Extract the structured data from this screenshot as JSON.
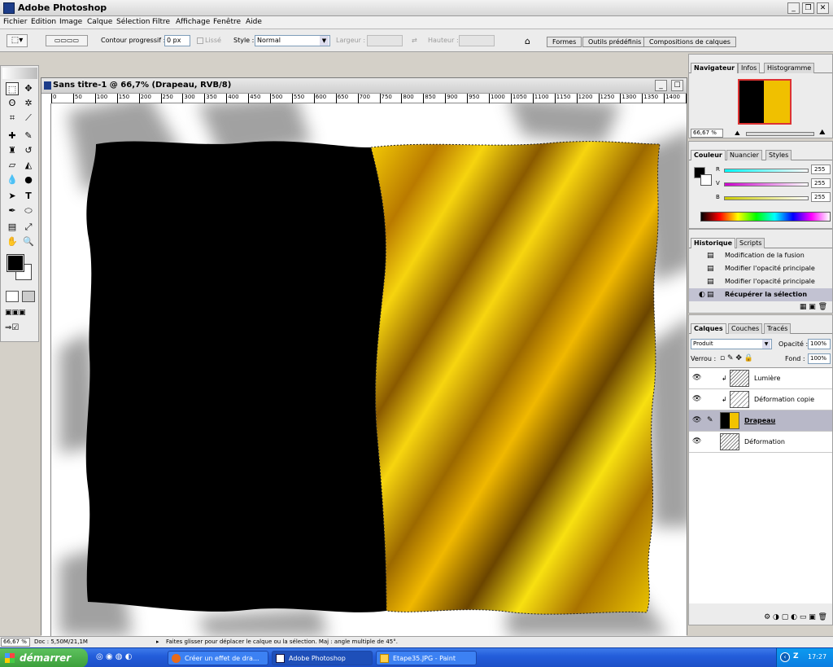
{
  "app": {
    "title": "Adobe Photoshop"
  },
  "menu": [
    "Fichier",
    "Edition",
    "Image",
    "Calque",
    "Sélection",
    "Filtre",
    "Affichage",
    "Fenêtre",
    "Aide"
  ],
  "options": {
    "feather_label": "Contour progressif :",
    "feather_value": "0 px",
    "antialias_label": "Lissé",
    "style_label": "Style :",
    "style_value": "Normal",
    "width_label": "Largeur :",
    "height_label": "Hauteur :",
    "wells": [
      "Formes",
      "Outils prédéfinis",
      "Compositions de calques"
    ]
  },
  "document": {
    "title": "Sans titre-1 @ 66,7% (Drapeau, RVB/8)",
    "ruler_ticks": [
      "0",
      "50",
      "100",
      "150",
      "200",
      "250",
      "300",
      "350",
      "400",
      "450",
      "500",
      "550",
      "600",
      "650",
      "700",
      "750",
      "800",
      "850",
      "900",
      "950",
      "1000",
      "1050",
      "1100",
      "1150",
      "1200",
      "1250",
      "1300",
      "1350",
      "1400",
      "14"
    ],
    "flag_colors": {
      "left": "#000000",
      "right": "#f3c400"
    }
  },
  "navigator": {
    "tabs": [
      "Navigateur",
      "Infos",
      "Histogramme"
    ],
    "zoom": "66,67 %"
  },
  "color": {
    "tabs": [
      "Couleur",
      "Nuancier",
      "Styles"
    ],
    "channels": [
      {
        "name": "R",
        "value": "255"
      },
      {
        "name": "V",
        "value": "255"
      },
      {
        "name": "B",
        "value": "255"
      }
    ],
    "foreground": "#000000",
    "background": "#ffffff"
  },
  "history": {
    "tabs": [
      "Historique",
      "Scripts"
    ],
    "items": [
      "Modification de la fusion",
      "Modifier l'opacité principale",
      "Modifier l'opacité principale",
      "Récupérer la sélection"
    ]
  },
  "layers": {
    "tabs": [
      "Calques",
      "Couches",
      "Tracés"
    ],
    "blend_mode": "Produit",
    "opacity_label": "Opacité :",
    "opacity_value": "100%",
    "lock_label": "Verrou :",
    "fill_label": "Fond :",
    "fill_value": "100%",
    "items": [
      "Lumière",
      "Déformation copie",
      "Drapeau",
      "Déformation"
    ]
  },
  "status": {
    "zoom": "66,67 %",
    "doc": "Doc : 5,50M/21,1M",
    "hint": "Faites glisser pour déplacer le calque ou la sélection. Maj : angle multiple de 45°."
  },
  "taskbar": {
    "start": "démarrer",
    "tasks": [
      "Créer un effet de dra...",
      "Adobe Photoshop",
      "Etape35.JPG - Paint"
    ],
    "tray_lang": "Z",
    "clock": "17:27"
  }
}
